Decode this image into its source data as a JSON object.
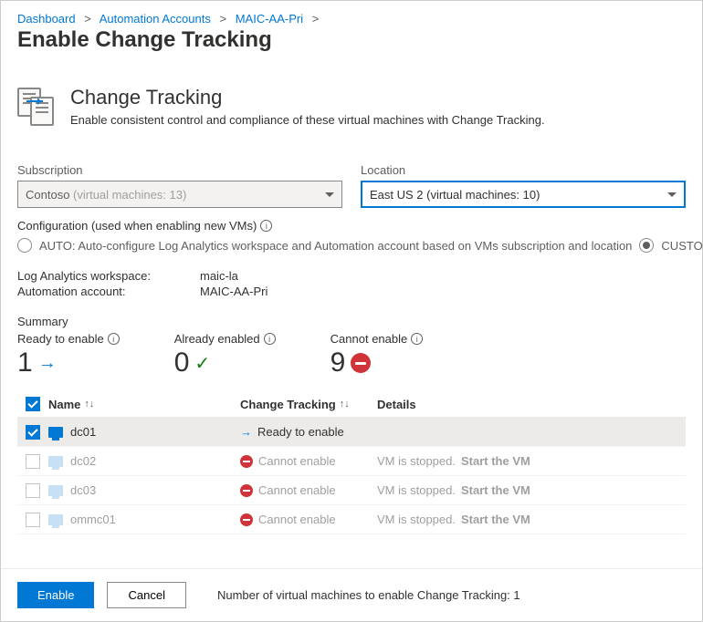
{
  "breadcrumb": [
    {
      "label": "Dashboard"
    },
    {
      "label": "Automation Accounts"
    },
    {
      "label": "MAIC-AA-Pri"
    }
  ],
  "page_title": "Enable Change Tracking",
  "section": {
    "title": "Change Tracking",
    "description": "Enable consistent control and compliance of these virtual machines with Change Tracking."
  },
  "form": {
    "subscription_label": "Subscription",
    "subscription_value": "Contoso",
    "subscription_suffix": "(virtual machines: 13)",
    "location_label": "Location",
    "location_value": "East US 2 (virtual machines: 10)"
  },
  "configuration": {
    "label": "Configuration (used when enabling new VMs)",
    "auto_label": "AUTO: Auto-configure Log Analytics workspace and Automation account based on VMs subscription and location",
    "custom_label": "CUSTOM:"
  },
  "workspace": {
    "la_key": "Log Analytics workspace:",
    "la_val": "maic-la",
    "aa_key": "Automation account:",
    "aa_val": "MAIC-AA-Pri"
  },
  "summary": {
    "heading": "Summary",
    "ready_label": "Ready to enable",
    "ready_count": "1",
    "already_label": "Already enabled",
    "already_count": "0",
    "cannot_label": "Cannot enable",
    "cannot_count": "9"
  },
  "table": {
    "col_name": "Name",
    "col_ct": "Change Tracking",
    "col_details": "Details",
    "rows": [
      {
        "name": "dc01",
        "status": "Ready to enable",
        "status_type": "ready",
        "detail": "",
        "action": "",
        "checked": true,
        "disabled": false
      },
      {
        "name": "dc02",
        "status": "Cannot enable",
        "status_type": "cannot",
        "detail": "VM is stopped.",
        "action": "Start the VM",
        "checked": false,
        "disabled": true
      },
      {
        "name": "dc03",
        "status": "Cannot enable",
        "status_type": "cannot",
        "detail": "VM is stopped.",
        "action": "Start the VM",
        "checked": false,
        "disabled": true
      },
      {
        "name": "ommc01",
        "status": "Cannot enable",
        "status_type": "cannot",
        "detail": "VM is stopped.",
        "action": "Start the VM",
        "checked": false,
        "disabled": true
      }
    ]
  },
  "footer": {
    "enable": "Enable",
    "cancel": "Cancel",
    "text": "Number of virtual machines to enable Change Tracking: 1"
  }
}
